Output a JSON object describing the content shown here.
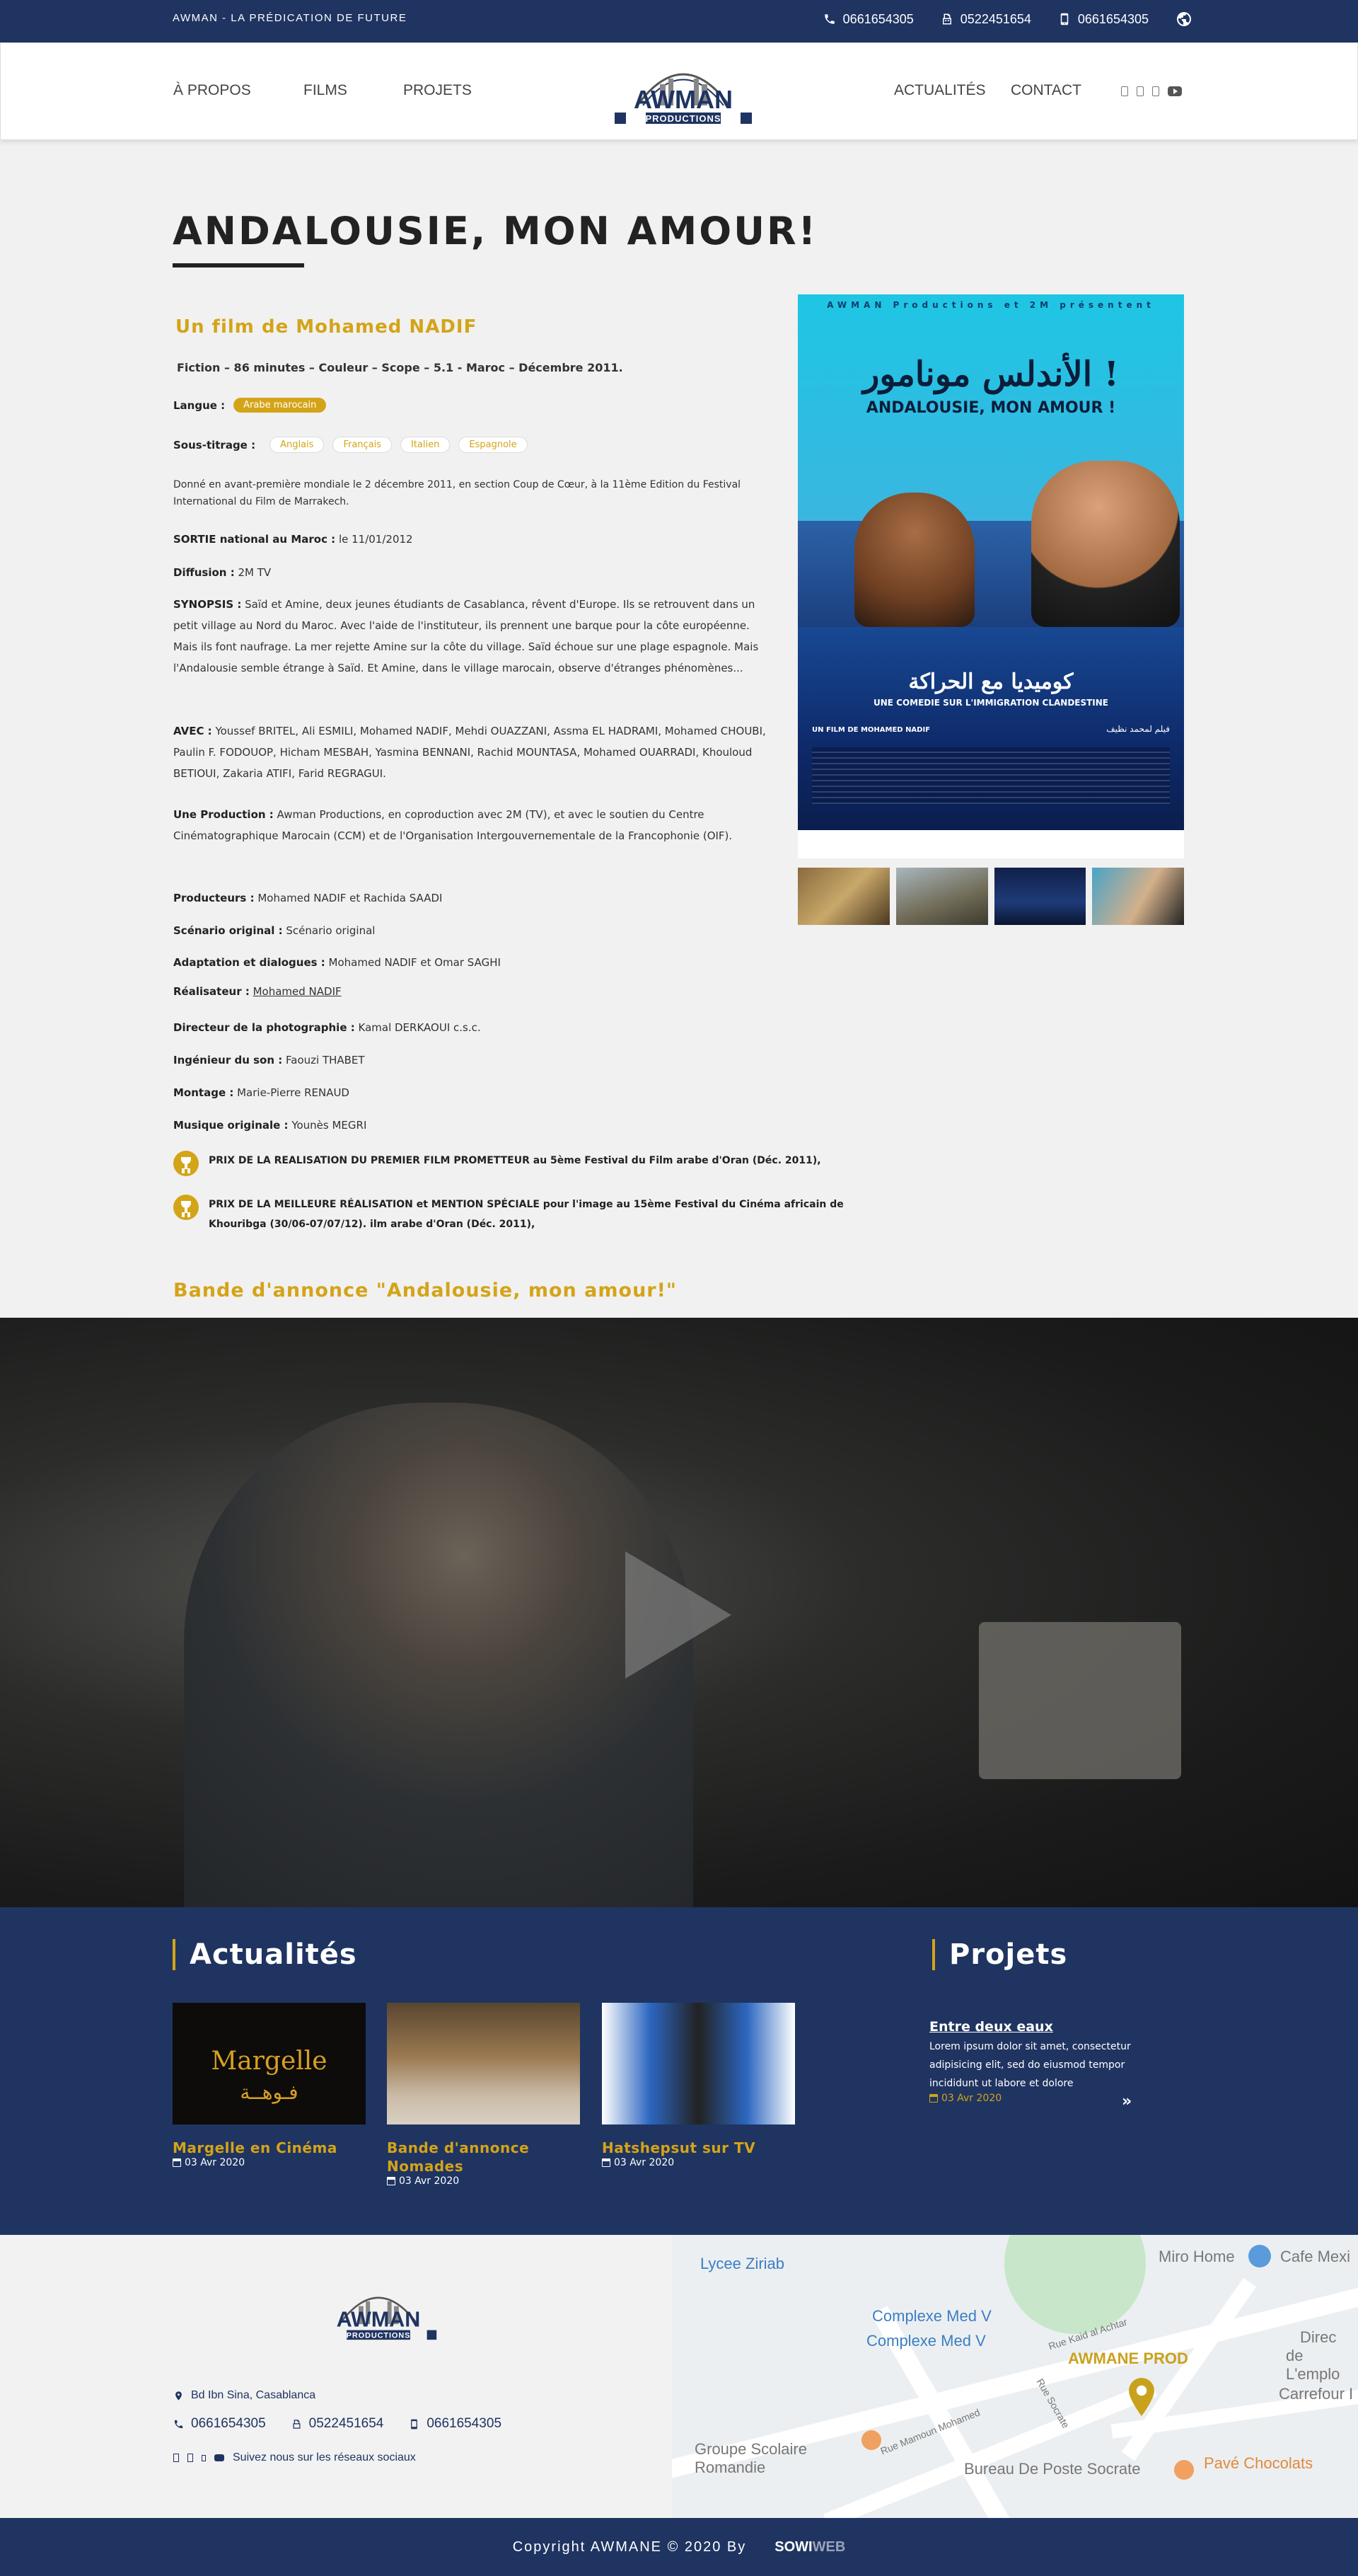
{
  "topbar": {
    "tagline": "AWMAN - LA PRÉDICATION DE FUTURE",
    "phone1": "0661654305",
    "fax": "0522451654",
    "mobile": "0661654305"
  },
  "nav": {
    "apropos": "À PROPOS",
    "films": "FILMS",
    "projets": "PROJETS",
    "actualites": "ACTUALITÉS",
    "contact": "CONTACT"
  },
  "logo": {
    "top": "AWMAN",
    "bottom": "PRODUCTIONS"
  },
  "film": {
    "title": "ANDALOUSIE, MON AMOUR!",
    "subtitle": "Un film de Mohamed NADIF",
    "specs": "Fiction – 86 minutes – Couleur – Scope  – 5.1 -  Maroc  – Décembre 2011.",
    "langue_label": "Langue :",
    "langue": "Arabe marocain",
    "soustitrage_label": "Sous-titrage :",
    "soustitrages": [
      "Anglais",
      "Français",
      "Italien",
      "Espagnole"
    ],
    "premiere": "Donné en avant-première mondiale le 2 décembre 2011, en section Coup de Cœur, à la 11ème Edition du Festival International du Film de Marrakech.",
    "sortie_label": "SORTIE  national au Maroc :",
    "sortie": " le 11/01/2012",
    "diffusion_label": "Diffusion :",
    "diffusion": " 2M TV",
    "synopsis_label": "SYNOPSIS :",
    "synopsis": " Saïd et Amine, deux jeunes étudiants de Casablanca, rêvent d'Europe. Ils se retrouvent dans un petit village au Nord du Maroc. Avec l'aide de l'instituteur, ils prennent une barque pour la côte européenne.  Mais ils font naufrage. La mer rejette Amine sur la côte du village. Saïd échoue sur une plage espagnole. Mais l'Andalousie semble étrange à Saïd. Et Amine, dans le village marocain, observe d'étranges phénomènes...",
    "avec_label": "AVEC :",
    "avec": " Youssef BRITEL, Ali ESMILI, Mohamed NADIF, Mehdi OUAZZANI, Assma EL HADRAMI, Mohamed CHOUBI, Paulin F. FODOUOP, Hicham MESBAH, Yasmina BENNANI, Rachid MOUNTASA, Mohamed OUARRADI, Khouloud BETIOUI, Zakaria ATIFI, Farid REGRAGUI.",
    "production_label": "Une Production :",
    "production": " Awman Productions, en coproduction avec 2M (TV), et avec le soutien du Centre Cinématographique Marocain (CCM) et de l'Organisation Intergouvernementale de la Francophonie (OIF).",
    "producteurs_label": "Producteurs :",
    "producteurs": " Mohamed NADIF et Rachida SAADI",
    "scenario_label": "Scénario original :",
    "scenario": " Scénario original",
    "adaptation_label": "Adaptation et dialogues :",
    "adaptation": " Mohamed NADIF et Omar SAGHI",
    "realisateur_label": "Réalisateur :",
    "realisateur": "Mohamed NADIF",
    "photo_label": "Directeur de la photographie  :",
    "photo": " Kamal DERKAOUI c.s.c.",
    "son_label": "Ingénieur du son :",
    "son": " Faouzi THABET",
    "montage_label": "Montage :",
    "montage": " Marie-Pierre RENAUD",
    "musique_label": "Musique originale :",
    "musique": " Younès MEGRI",
    "award1": "PRIX DE LA REALISATION DU PREMIER FILM PROMETTEUR au 5ème Festival du Film arabe d'Oran (Déc. 2011),",
    "award2": "PRIX DE LA MEILLEURE RÉALISATION et MENTION SPÉCIALE pour l'image au 15ème Festival du Cinéma africain de Khouribga (30/06-07/07/12). ilm arabe d'Oran (Déc. 2011),",
    "trailer_title": "Bande d'annonce \"Andalousie, mon amour!\""
  },
  "poster": {
    "top": "AWMAN Productions et 2M présentent",
    "arabic_title": "الأندلس مونامور !",
    "title": "ANDALOUSIE, MON AMOUR !",
    "arabic_sub": "كوميديا مع الحراكة",
    "sub": "UNE COMEDIE SUR L'IMMIGRATION CLANDESTINE",
    "credit_left": "UN FILM DE MOHAMED NADIF",
    "credit_right": "فيلم لمحمد نظيف"
  },
  "news": {
    "title": "Actualités",
    "cards": [
      {
        "title": "Margelle en Cinéma",
        "date": "03 Avr 2020",
        "img_text": "Margelle",
        "img_ar": "فـوهــة"
      },
      {
        "title": "Bande d'annonce Nomades",
        "date": "03 Avr 2020"
      },
      {
        "title": "Hatshepsut sur TV",
        "date": "03 Avr 2020"
      }
    ]
  },
  "projects": {
    "title": "Projets",
    "item": {
      "title": "Entre deux eaux",
      "text": "Lorem ipsum dolor sit amet, consectetur adipisicing elit, sed do eiusmod tempor incididunt ut labore et dolore",
      "date": "03 Avr 2020"
    }
  },
  "footer": {
    "address": "Bd Ibn Sina, Casablanca",
    "phone1": "0661654305",
    "fax": "0522451654",
    "mobile": "0661654305",
    "follow": "Suivez nous sur les réseaux sociaux"
  },
  "map": {
    "lycee": "Lycee Ziriab",
    "complexe1": "Complexe Med V",
    "complexe2": "Complexe Med V",
    "miro": "Miro Home",
    "cafe": "Cafe Mexi",
    "direction": "Direc",
    "emploi": "de L'emplo",
    "carrefour": "Carrefour I",
    "awmane": "AWMANE PROD",
    "groupe1": "Groupe Scolaire",
    "groupe2": "Romandie",
    "bureau": "Bureau De Poste Socrate",
    "pave": "Pavé Chocolats",
    "rue_kaid": "Rue Kaid al Achtar",
    "rue_socrate": "Rue Socrate",
    "rue_mamoun": "Rue Mamoun Mohamed"
  },
  "copyright": {
    "text": "Copyright AWMANE © 2020 By",
    "sowi": "SOWI",
    "web": "WEB"
  },
  "colors": {
    "navy": "#1f3461",
    "gold": "#d4a418"
  }
}
